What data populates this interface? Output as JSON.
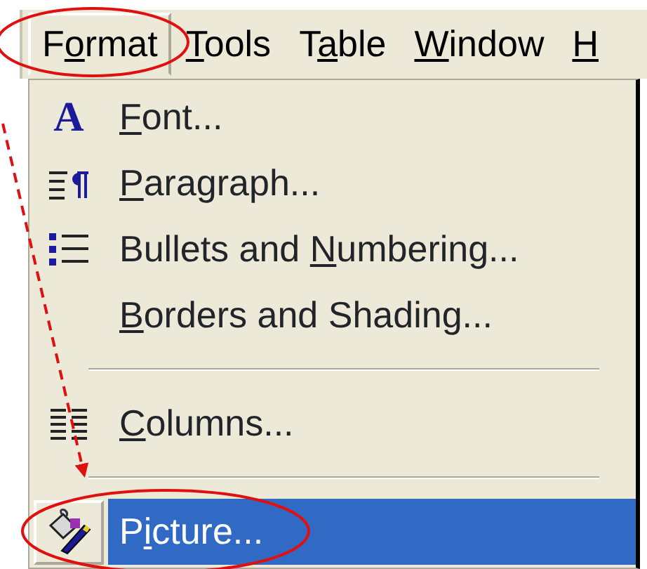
{
  "menu_bar": [
    {
      "label_start": "F",
      "access_key": "o",
      "label_end": "rmat",
      "selected": true
    },
    {
      "access_key": "T",
      "label_end": "ools",
      "selected": false
    },
    {
      "label_start": "T",
      "access_key": "a",
      "label_end": "ble",
      "selected": false
    },
    {
      "access_key": "W",
      "label_end": "indow",
      "selected": false
    },
    {
      "access_key": "H",
      "selected": false
    }
  ],
  "menu": [
    {
      "kind": "font",
      "icon_glyph": "A",
      "access_key": "F",
      "label_end": "ont...",
      "highlighted": false
    },
    {
      "kind": "paragraph",
      "access_key": "P",
      "label_end": "aragraph...",
      "highlighted": false
    },
    {
      "kind": "bullets",
      "label_start": "Bullets and ",
      "access_key": "N",
      "label_end": "umbering...",
      "highlighted": false
    },
    {
      "kind": "plain",
      "access_key": "B",
      "label_end": "orders and Shading...",
      "highlighted": false
    },
    {
      "kind": "separator"
    },
    {
      "kind": "columns",
      "access_key": "C",
      "label_end": "olumns...",
      "highlighted": false
    },
    {
      "kind": "separator"
    },
    {
      "kind": "picture",
      "label_start": "P",
      "access_key": "i",
      "label_end": "cture...",
      "highlighted": true
    }
  ]
}
